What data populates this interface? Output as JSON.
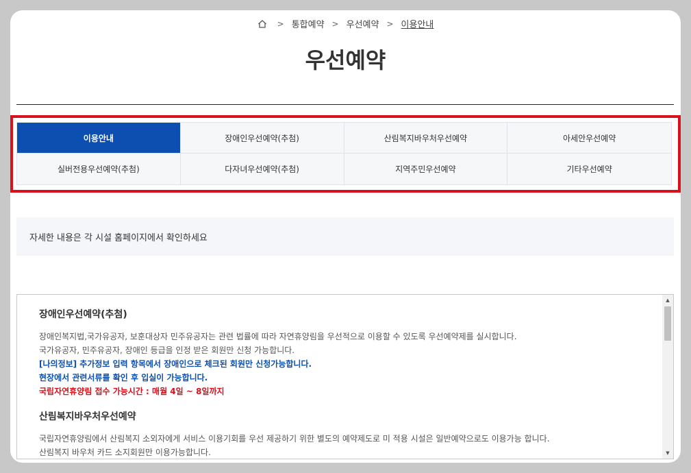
{
  "breadcrumb": {
    "items": [
      "통합예약",
      "우선예약",
      "이용안내"
    ]
  },
  "page": {
    "title": "우선예약"
  },
  "tabs": [
    {
      "label": "이용안내",
      "active": true
    },
    {
      "label": "장애인우선예약(추첨)",
      "active": false
    },
    {
      "label": "산림복지바우처우선예약",
      "active": false
    },
    {
      "label": "아세안우선예약",
      "active": false
    },
    {
      "label": "실버전용우선예약(추첨)",
      "active": false
    },
    {
      "label": "다자녀우선예약(추첨)",
      "active": false
    },
    {
      "label": "지역주민우선예약",
      "active": false
    },
    {
      "label": "기타우선예약",
      "active": false
    }
  ],
  "notice": {
    "text": "자세한 내용은 각 시설 홈페이지에서 확인하세요"
  },
  "content": {
    "section1": {
      "title": "장애인우선예약(추첨)",
      "line1": "장애인복지법,국가유공자, 보훈대상자 민주유공자는 관련 법률에 따라 자연휴양림을 우선적으로 이용할 수 있도록 우선예약제를 실시합니다.",
      "line2": "국가유공자, 민주유공자, 장애인 등급을 인정 받은 회원만 신청 가능합니다.",
      "line3": "[나의정보] 추가정보 입력 항목에서 장애인으로 체크된 회원만 신청가능합니다.",
      "line4": "현장에서 관련서류를 확인 후 입실이 가능합니다.",
      "line5": "국립자연휴양림 접수 가능시간 : 매월 4일 ~ 8일까지"
    },
    "section2": {
      "title": "산림복지바우처우선예약",
      "line1": "국립자연휴양림에서 산림복지 소외자에게 서비스 이용기회를 우선 제공하기 위한 별도의 예약제도로 미 적용 시설은 일반예약으로도 이용가능 합니다.",
      "line2": "산림복지 바우처 카드 소지회원만 이용가능합니다."
    }
  },
  "colors": {
    "accent": "#0c4fb0",
    "highlight": "#d8111b"
  }
}
